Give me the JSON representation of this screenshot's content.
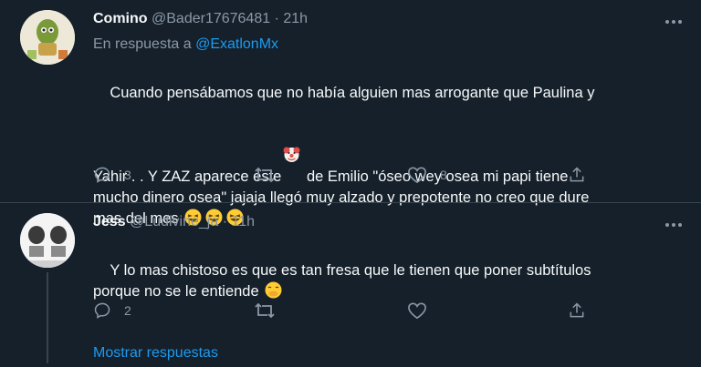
{
  "tweets": [
    {
      "name": "Comino",
      "handle": "@Bader17676481",
      "time": "· 21h",
      "reply_prefix": "En respuesta a",
      "reply_link": "@ExatlonMx",
      "text_part1": "Cuando pensábamos que no había alguien mas arrogante que Paulina y\nYahir . . Y ZAZ aparece este",
      "text_part2": " de Emilio \"óseo wey osea mi papi tiene\nmucho dinero osea\" jajaja llegó muy alzado y prepotente no creo que dure\nmas del mes ",
      "reply_count": "3",
      "retweet_count": "",
      "like_count": "8"
    },
    {
      "name": "Jess",
      "handle": "@Ludivine_ja",
      "time": "· 11h",
      "text": "Y lo mas chistoso es que es tan fresa que le tienen que poner subtítulos\nporque no se le entiende ",
      "reply_count": "2",
      "retweet_count": "",
      "like_count": ""
    }
  ],
  "show_replies": "Mostrar respuestas",
  "icons": {
    "clown": "clown-emoji",
    "grin": "grinning-squinting-emoji",
    "blush": "hand-over-mouth-emoji"
  },
  "colors": {
    "background": "#15202b",
    "accent": "#1d9bf0",
    "muted": "#8b98a5",
    "divider": "#38444d"
  }
}
